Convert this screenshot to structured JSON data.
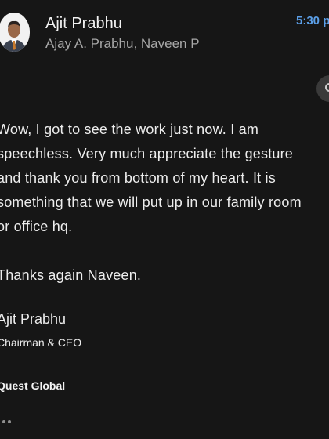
{
  "header": {
    "sender_name": "Ajit Prabhu",
    "recipients": "Ajay A. Prabhu, Naveen P",
    "timestamp": "5:30 p",
    "avatar_icon": "person-avatar-icon",
    "more_icon": "more-options-icon"
  },
  "message": {
    "lines": [
      "Wow, I got to see the work just now.  I am",
      "speechless. Very much appreciate the gesture",
      "and thank you from bottom of my heart. It is",
      "something that we will put up in our family room",
      "or office hq."
    ],
    "thanks": "Thanks again Naveen.",
    "signature": {
      "name": "Ajit Prabhu",
      "title": "Chairman & CEO",
      "company": "Quest Global"
    },
    "expand_icon": "ellipsis-expand-icon"
  },
  "colors": {
    "background": "#161616",
    "text": "#ededed",
    "secondary_text": "#a8a8a8",
    "accent": "#5b9fe8"
  }
}
